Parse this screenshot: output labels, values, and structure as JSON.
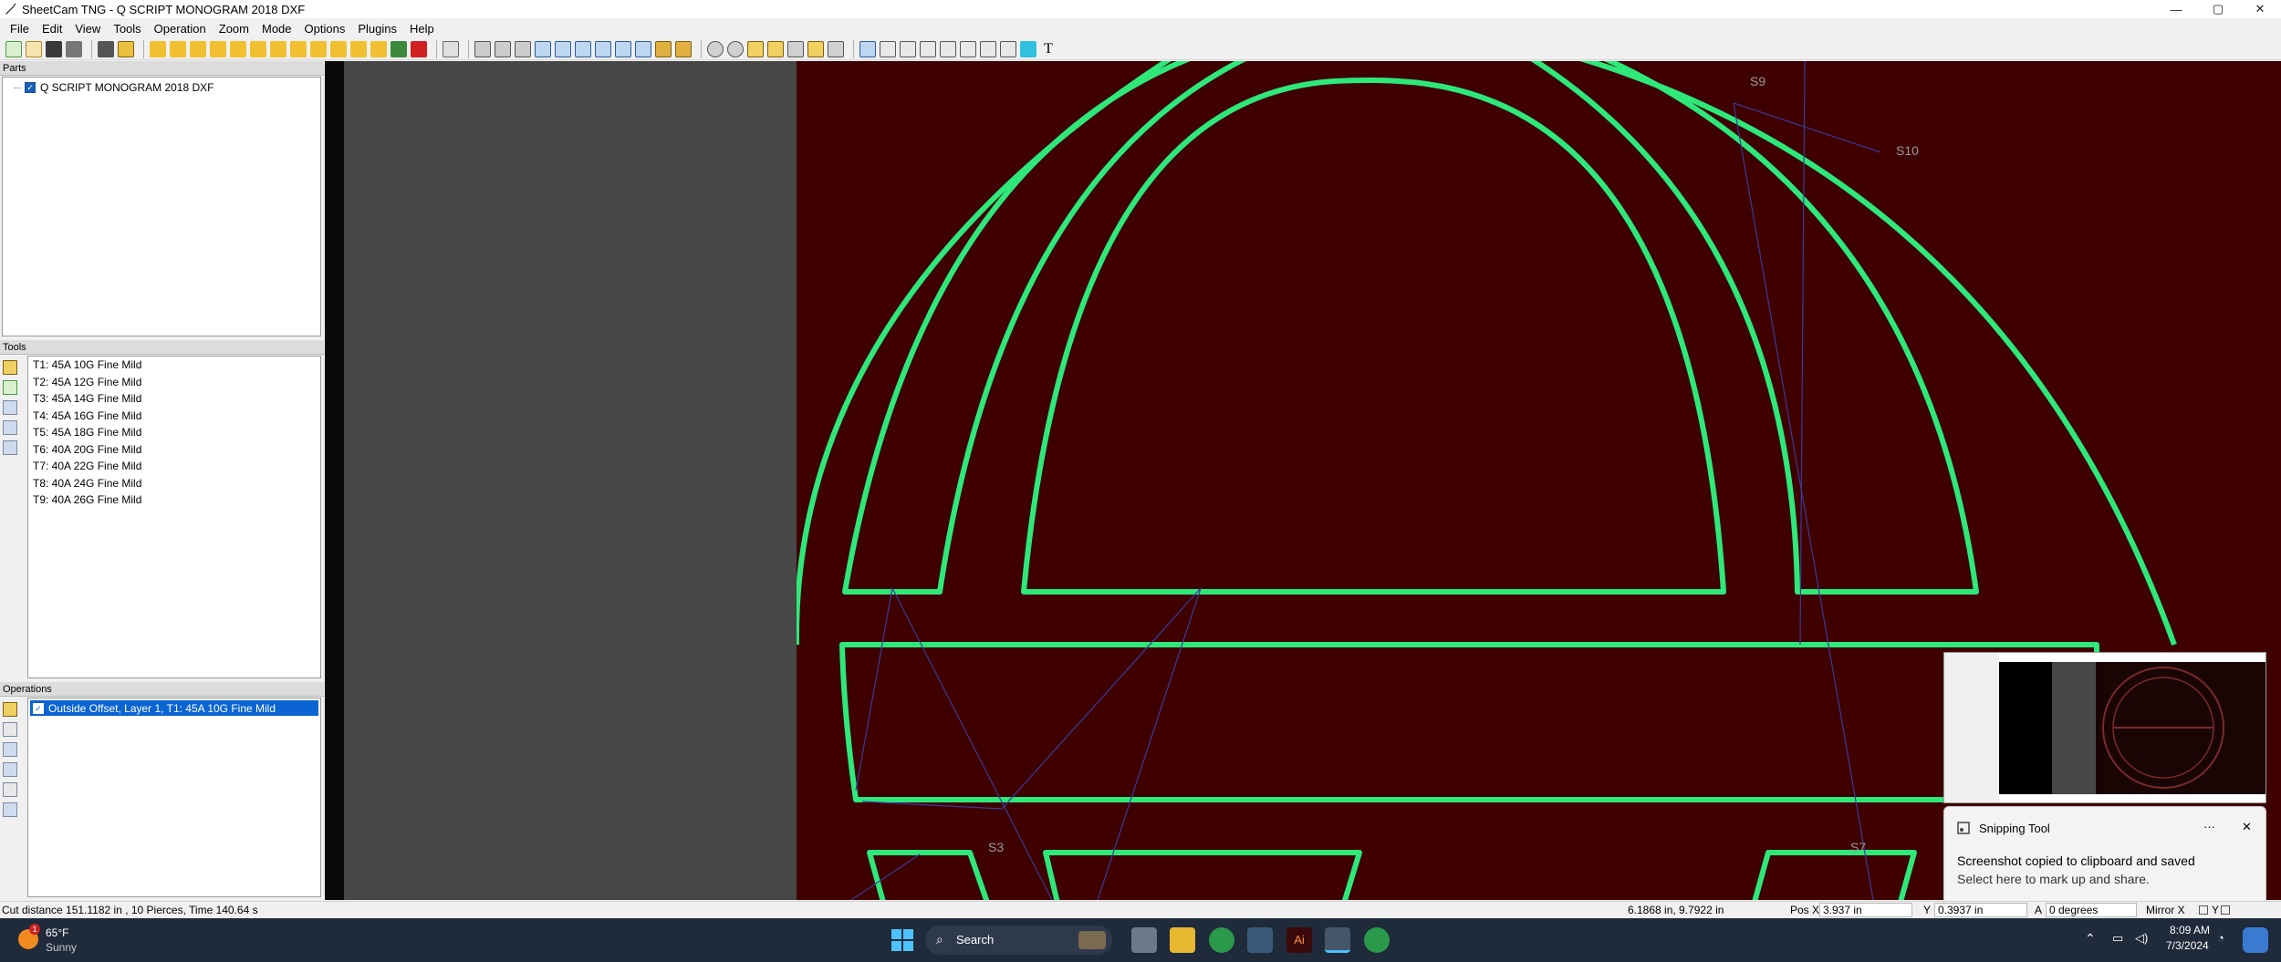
{
  "window": {
    "title": "SheetCam TNG - Q SCRIPT MONOGRAM 2018 DXF",
    "minimize": "—",
    "maximize": "▢",
    "close": "✕"
  },
  "menu": [
    "File",
    "Edit",
    "View",
    "Tools",
    "Operation",
    "Zoom",
    "Mode",
    "Options",
    "Plugins",
    "Help"
  ],
  "toolbar": {
    "text_tool": "T"
  },
  "parts": {
    "header": "Parts",
    "items": [
      {
        "label": "Q SCRIPT MONOGRAM 2018 DXF",
        "checked": true
      }
    ]
  },
  "tools": {
    "header": "Tools",
    "items": [
      "T1: 45A 10G Fine Mild",
      "T2: 45A 12G Fine Mild",
      "T3: 45A 14G Fine Mild",
      "T4: 45A 16G Fine Mild",
      "T5: 45A 18G Fine Mild",
      "T6: 40A 20G Fine Mild",
      "T7: 40A 22G Fine Mild",
      "T8: 40A 24G Fine Mild",
      "T9: 40A 26G Fine Mild"
    ]
  },
  "operations": {
    "header": "Operations",
    "items": [
      {
        "label": "Outside Offset, Layer 1, T1: 45A 10G Fine Mild",
        "checked": true,
        "selected": true
      }
    ]
  },
  "canvas": {
    "background": "#3f0000",
    "path_color": "#2ee87a",
    "rapid_color": "#3a3a9a",
    "labels": [
      "S9",
      "S10",
      "S3",
      "S7"
    ]
  },
  "status": {
    "cut_info": "Cut distance 151.1182 in , 10 Pierces, Time 140.64 s",
    "cursor": "6.1868 in, 9.7922 in",
    "pos_x_label": "Pos X",
    "pos_x": "3.937 in",
    "y_label": "Y",
    "y": "0.3937 in",
    "angle_label": "A",
    "angle": "0 degrees",
    "mirror": "Mirror X",
    "mirror_y": "Y"
  },
  "snipping": {
    "app": "Snipping Tool",
    "more": "···",
    "close": "✕",
    "message": "Screenshot copied to clipboard and saved",
    "sub": "Select here to mark up and share."
  },
  "taskbar": {
    "weather_temp": "65°F",
    "weather_desc": "Sunny",
    "weather_badge": "1",
    "search": "Search",
    "time": "8:09 AM",
    "date": "7/3/2024"
  }
}
